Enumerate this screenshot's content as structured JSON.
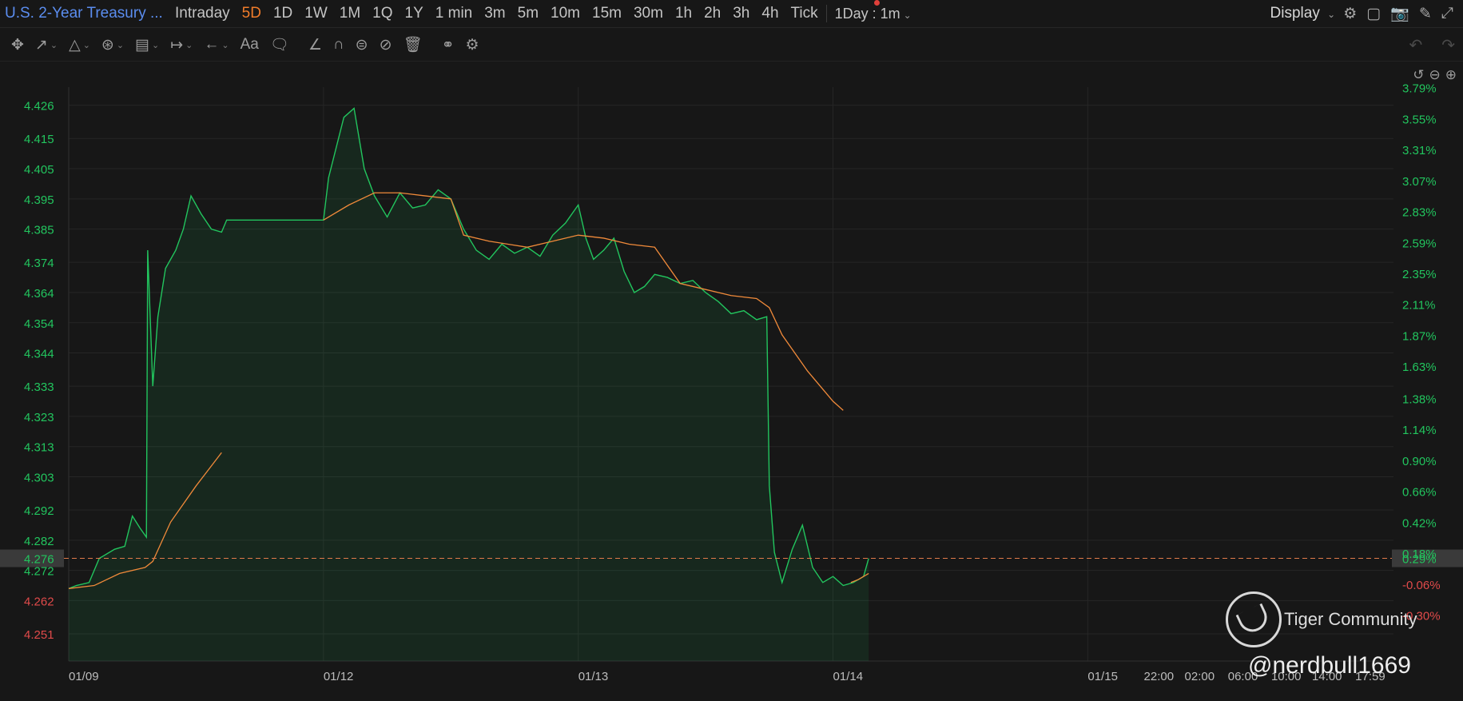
{
  "header": {
    "title": "U.S. 2-Year Treasury ...",
    "periods": [
      "Intraday",
      "5D",
      "1D",
      "1W",
      "1M",
      "1Q",
      "1Y",
      "1 min",
      "3m",
      "5m",
      "10m",
      "15m",
      "30m",
      "1h",
      "2h",
      "3h",
      "4h",
      "Tick"
    ],
    "active_period": "5D",
    "interval_label": "1Day : 1m",
    "display_label": "Display"
  },
  "toolbar": {
    "icons": [
      "move-icon",
      "trend-line-icon",
      "polyline-icon",
      "pattern-icon",
      "fibonacci-icon",
      "measure-icon",
      "arrow-icon",
      "text-icon",
      "note-icon",
      "eraser-pen-icon",
      "magnet-icon",
      "lock-icon",
      "hide-icon",
      "delete-icon",
      "layers-icon",
      "settings-icon"
    ],
    "text_tool_label": "Aa"
  },
  "chart_data": {
    "type": "line",
    "title": "",
    "x_labels": [
      "01/09",
      "01/12",
      "01/13",
      "01/14",
      "01/15",
      "22:00",
      "02:00",
      "06:00",
      "10:00",
      "14:00",
      "17:59"
    ],
    "y_ticks": [
      4.426,
      4.415,
      4.405,
      4.395,
      4.385,
      4.374,
      4.364,
      4.354,
      4.344,
      4.333,
      4.323,
      4.313,
      4.303,
      4.292,
      4.282,
      4.272,
      4.262,
      4.251
    ],
    "y_tick_colors_below_prev_close": "#e04a4a",
    "pct_ticks": [
      "3.79%",
      "3.55%",
      "3.31%",
      "3.07%",
      "2.83%",
      "2.59%",
      "2.35%",
      "2.11%",
      "1.87%",
      "1.63%",
      "1.38%",
      "1.14%",
      "0.90%",
      "0.66%",
      "0.42%",
      "0.29%",
      "0.18%",
      "-0.06%",
      "-0.30%"
    ],
    "ylim": [
      4.242,
      4.432
    ],
    "current_price": "4.276",
    "current_pct": "0.29%",
    "colors": {
      "price": "#22c55e",
      "average": "#f08a3a",
      "negative": "#e04a4a",
      "current_line": "#e07a4a"
    },
    "price_series": [
      [
        0,
        4.266
      ],
      [
        0.03,
        4.267
      ],
      [
        0.08,
        4.268
      ],
      [
        0.12,
        4.276
      ],
      [
        0.18,
        4.279
      ],
      [
        0.22,
        4.28
      ],
      [
        0.25,
        4.29
      ],
      [
        0.28,
        4.286
      ],
      [
        0.305,
        4.283
      ],
      [
        0.31,
        4.378
      ],
      [
        0.33,
        4.333
      ],
      [
        0.35,
        4.356
      ],
      [
        0.38,
        4.372
      ],
      [
        0.42,
        4.378
      ],
      [
        0.45,
        4.385
      ],
      [
        0.48,
        4.396
      ],
      [
        0.52,
        4.39
      ],
      [
        0.56,
        4.385
      ],
      [
        0.6,
        4.384
      ],
      [
        0.62,
        4.388
      ],
      [
        1.0,
        4.388
      ],
      [
        1.02,
        4.402
      ],
      [
        1.05,
        4.412
      ],
      [
        1.08,
        4.422
      ],
      [
        1.12,
        4.425
      ],
      [
        1.16,
        4.405
      ],
      [
        1.2,
        4.396
      ],
      [
        1.25,
        4.389
      ],
      [
        1.3,
        4.397
      ],
      [
        1.35,
        4.392
      ],
      [
        1.4,
        4.393
      ],
      [
        1.45,
        4.398
      ],
      [
        1.5,
        4.395
      ],
      [
        1.55,
        4.385
      ],
      [
        1.6,
        4.378
      ],
      [
        1.65,
        4.375
      ],
      [
        1.7,
        4.38
      ],
      [
        1.75,
        4.377
      ],
      [
        1.8,
        4.379
      ],
      [
        1.85,
        4.376
      ],
      [
        1.9,
        4.383
      ],
      [
        1.95,
        4.387
      ],
      [
        2.0,
        4.393
      ],
      [
        2.03,
        4.382
      ],
      [
        2.06,
        4.375
      ],
      [
        2.1,
        4.378
      ],
      [
        2.14,
        4.382
      ],
      [
        2.18,
        4.371
      ],
      [
        2.22,
        4.364
      ],
      [
        2.26,
        4.366
      ],
      [
        2.3,
        4.37
      ],
      [
        2.35,
        4.369
      ],
      [
        2.4,
        4.367
      ],
      [
        2.45,
        4.368
      ],
      [
        2.5,
        4.364
      ],
      [
        2.55,
        4.361
      ],
      [
        2.6,
        4.357
      ],
      [
        2.65,
        4.358
      ],
      [
        2.7,
        4.355
      ],
      [
        2.74,
        4.356
      ],
      [
        2.75,
        4.3
      ],
      [
        2.77,
        4.278
      ],
      [
        2.8,
        4.268
      ],
      [
        2.84,
        4.279
      ],
      [
        2.88,
        4.287
      ],
      [
        2.92,
        4.273
      ],
      [
        2.96,
        4.268
      ],
      [
        3.0,
        4.27
      ],
      [
        3.04,
        4.267
      ],
      [
        3.08,
        4.268
      ],
      [
        3.12,
        4.27
      ],
      [
        3.14,
        4.276
      ]
    ],
    "average_series": [
      [
        0,
        4.266
      ],
      [
        0.1,
        4.267
      ],
      [
        0.2,
        4.271
      ],
      [
        0.3,
        4.273
      ],
      [
        0.33,
        4.275
      ],
      [
        0.4,
        4.288
      ],
      [
        0.5,
        4.3
      ],
      [
        0.6,
        4.311
      ],
      [
        1.0,
        4.388
      ],
      [
        1.1,
        4.393
      ],
      [
        1.2,
        4.397
      ],
      [
        1.3,
        4.397
      ],
      [
        1.4,
        4.396
      ],
      [
        1.5,
        4.395
      ],
      [
        1.55,
        4.383
      ],
      [
        1.65,
        4.381
      ],
      [
        1.8,
        4.379
      ],
      [
        1.9,
        4.381
      ],
      [
        2.0,
        4.383
      ],
      [
        2.1,
        4.382
      ],
      [
        2.2,
        4.38
      ],
      [
        2.3,
        4.379
      ],
      [
        2.4,
        4.367
      ],
      [
        2.5,
        4.365
      ],
      [
        2.6,
        4.363
      ],
      [
        2.7,
        4.362
      ],
      [
        2.75,
        4.359
      ],
      [
        2.8,
        4.35
      ],
      [
        2.9,
        4.338
      ],
      [
        3.0,
        4.328
      ],
      [
        3.04,
        4.325
      ],
      [
        3.07,
        4.268
      ],
      [
        3.1,
        4.269
      ],
      [
        3.14,
        4.271
      ]
    ],
    "x_domain": [
      0,
      5.2
    ],
    "x_label_positions": [
      0.0,
      1.0,
      2.0,
      3.0,
      4.0,
      4.22,
      4.38,
      4.55,
      4.72,
      4.88,
      5.05
    ]
  },
  "watermark": {
    "community": "Tiger Community",
    "handle": "@nerdbull1669"
  }
}
